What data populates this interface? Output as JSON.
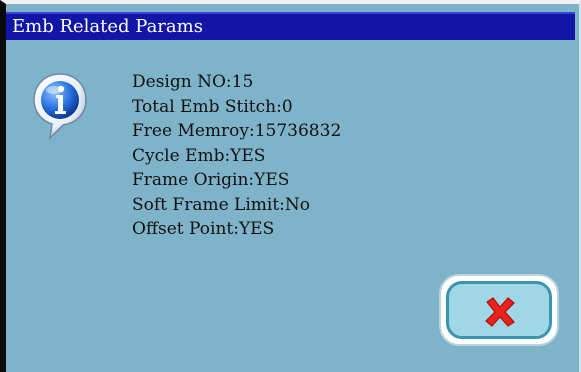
{
  "dialog": {
    "title": "Emb Related Params",
    "icon": "info-icon",
    "params": [
      "Design NO:15",
      "Total Emb Stitch:0",
      "Free Memroy:15736832",
      "Cycle Emb:YES",
      "Frame Origin:YES",
      "Soft Frame Limit:No",
      "Offset Point:YES"
    ],
    "close_button": {
      "icon": "close-icon",
      "icon_color": "#e8231c"
    }
  },
  "colors": {
    "background": "#7fb3c9",
    "titlebar": "#1116a8",
    "button_face": "#9fd7e6"
  }
}
